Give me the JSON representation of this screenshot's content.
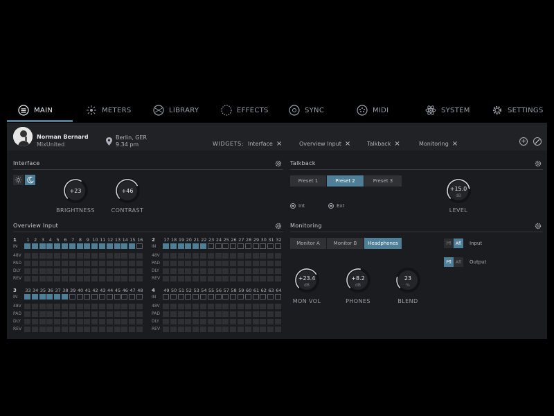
{
  "nav": {
    "items": [
      {
        "label": "MAIN",
        "icon": "main-icon"
      },
      {
        "label": "METERS",
        "icon": "meters-icon"
      },
      {
        "label": "LIBRARY",
        "icon": "library-icon"
      },
      {
        "label": "EFFECTS",
        "icon": "effects-icon"
      },
      {
        "label": "SYNC",
        "icon": "sync-icon"
      },
      {
        "label": "MIDI",
        "icon": "midi-icon"
      },
      {
        "label": "SYSTEM",
        "icon": "system-icon"
      },
      {
        "label": "SETTINGS",
        "icon": "settings-icon"
      }
    ],
    "active": "MAIN"
  },
  "header": {
    "user_name": "Norman Bernard",
    "user_org": "MixUnited",
    "location": "Berlin, GER",
    "time": "9.34 pm",
    "widgets_label": "WIDGETS:",
    "widgets": [
      "Interface",
      "Overview Input",
      "Talkback",
      "Monitoring"
    ],
    "add_label": "+"
  },
  "interface": {
    "title": "Interface",
    "brightness": {
      "value": "+23",
      "label": "BRIGHTNESS",
      "level": 0.62
    },
    "contrast": {
      "value": "+46",
      "label": "CONTRAST",
      "level": 0.74
    },
    "mode": "dark"
  },
  "talkback": {
    "title": "Talkback",
    "presets": [
      "Preset 1",
      "Preset 2",
      "Preset 3"
    ],
    "active_preset": 1,
    "level": {
      "value": "+15.0",
      "unit": "dB",
      "label": "LEVEL",
      "level": 0.8
    },
    "sources": [
      "Int",
      "Ext"
    ]
  },
  "overview": {
    "title": "Overview Input",
    "row_in": "IN",
    "row_labels": [
      "48V",
      "PAD",
      "DLY",
      "REV"
    ],
    "groups": [
      {
        "num": "1",
        "channels": [
          "1",
          "2",
          "3",
          "4",
          "5",
          "6",
          "7",
          "8",
          "9",
          "10",
          "11",
          "12",
          "13",
          "14",
          "15",
          "16"
        ],
        "in_active": 15
      },
      {
        "num": "2",
        "channels": [
          "17",
          "18",
          "19",
          "20",
          "21",
          "22",
          "23",
          "24",
          "25",
          "26",
          "27",
          "28",
          "29",
          "30",
          "31",
          "32"
        ],
        "in_active": 6
      },
      {
        "num": "3",
        "channels": [
          "33",
          "34",
          "35",
          "36",
          "37",
          "38",
          "39",
          "40",
          "41",
          "42",
          "43",
          "44",
          "45",
          "46",
          "47",
          "48"
        ],
        "in_active": 6
      },
      {
        "num": "4",
        "channels": [
          "49",
          "50",
          "51",
          "52",
          "53",
          "54",
          "55",
          "56",
          "57",
          "58",
          "59",
          "60",
          "61",
          "62",
          "63",
          "64"
        ],
        "in_active": 0
      }
    ]
  },
  "monitoring": {
    "title": "Monitoring",
    "tabs": [
      "Monitor A",
      "Monitor B",
      "Headphones"
    ],
    "active_tab": 2,
    "pfl": "Pfl",
    "afl": "Afl",
    "input_label": "Input",
    "output_label": "Output",
    "mon_vol": {
      "value": "+23.4",
      "unit": "dB",
      "label": "MON VOL",
      "level": 0.72
    },
    "phones": {
      "value": "+8.2",
      "unit": "dB",
      "label": "PHONES",
      "level": 0.55
    },
    "blend": {
      "value": "23",
      "unit": "%",
      "label": "BLEND",
      "level": 0.23
    }
  },
  "colors": {
    "accent": "#4f7f97",
    "panel": "#1b1c1f",
    "header": "#212226"
  }
}
